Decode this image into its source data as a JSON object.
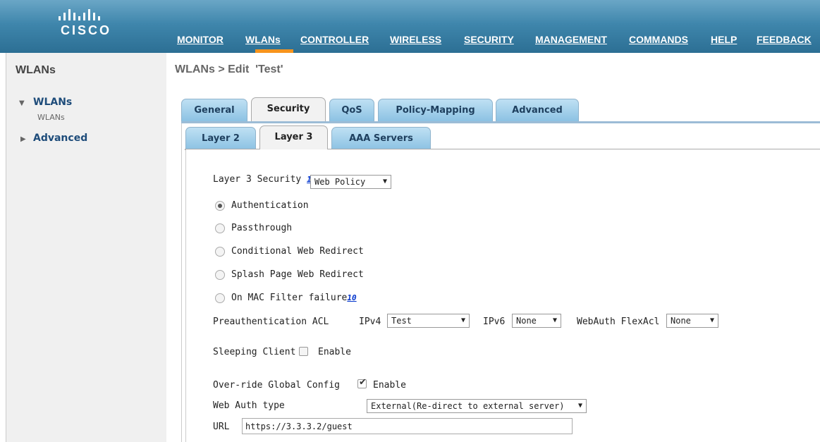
{
  "header": {
    "logo_text": "CISCO",
    "nav": [
      {
        "label": "MONITOR"
      },
      {
        "label": "WLANs"
      },
      {
        "label": "CONTROLLER"
      },
      {
        "label": "WIRELESS"
      },
      {
        "label": "SECURITY"
      },
      {
        "label": "MANAGEMENT"
      },
      {
        "label": "COMMANDS"
      },
      {
        "label": "HELP"
      },
      {
        "label": "FEEDBACK"
      }
    ],
    "active_nav": "WLANs",
    "accent_color": "#f7941d"
  },
  "sidebar": {
    "title": "WLANs",
    "items": [
      {
        "label": "WLANs",
        "expanded": true,
        "sub": "WLANs"
      },
      {
        "label": "Advanced",
        "expanded": false
      }
    ]
  },
  "page": {
    "title": "WLANs > Edit  'Test'"
  },
  "tabs": {
    "primary": [
      "General",
      "Security",
      "QoS",
      "Policy-Mapping",
      "Advanced"
    ],
    "primary_active": "Security",
    "secondary": [
      "Layer 2",
      "Layer 3",
      "AAA Servers"
    ],
    "secondary_active": "Layer 3"
  },
  "form": {
    "layer3_security_label": "Layer 3 Security",
    "layer3_security_footnote": "1",
    "layer3_security_value": "Web Policy",
    "radio_options": [
      {
        "label": "Authentication",
        "checked": true
      },
      {
        "label": "Passthrough",
        "checked": false
      },
      {
        "label": "Conditional Web Redirect",
        "checked": false
      },
      {
        "label": "Splash Page Web Redirect",
        "checked": false
      },
      {
        "label": "On MAC Filter failure",
        "checked": false,
        "footnote": "10"
      }
    ],
    "preauth_acl_label": "Preauthentication ACL",
    "ipv4_label": "IPv4",
    "ipv4_value": "Test",
    "ipv6_label": "IPv6",
    "ipv6_value": "None",
    "flexacl_label": "WebAuth FlexAcl",
    "flexacl_value": "None",
    "sleeping_client_label": "Sleeping Client",
    "sleeping_client_enable": "Enable",
    "sleeping_client_checked": false,
    "override_label": "Over-ride Global Config",
    "override_enable": "Enable",
    "override_checked": true,
    "web_auth_type_label": "Web Auth type",
    "web_auth_type_value": "External(Re-direct to external server)",
    "url_label": "URL",
    "url_value": "https://3.3.3.2/guest"
  }
}
